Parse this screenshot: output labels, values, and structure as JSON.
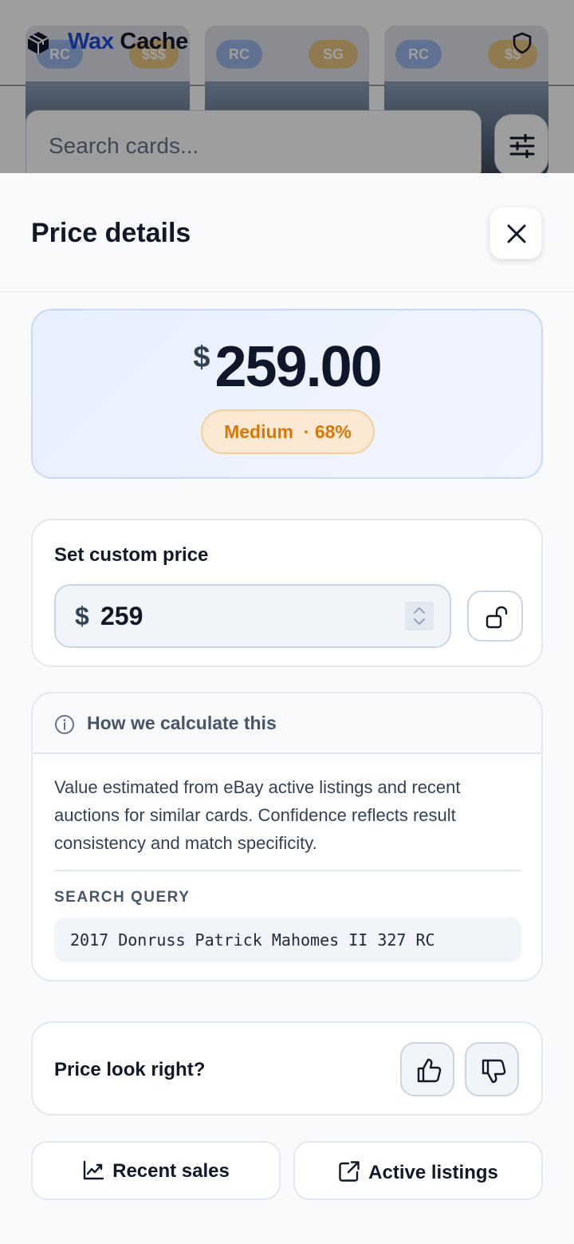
{
  "app": {
    "name_part1": "Wax",
    "name_part2": "Cache",
    "search_placeholder": "Search cards...",
    "card_badges": [
      {
        "left": "RC",
        "right": "$$$"
      },
      {
        "left": "RC",
        "right": "SG"
      },
      {
        "left": "RC",
        "right": "$$"
      }
    ]
  },
  "sheet": {
    "title": "Price details",
    "estimate": {
      "currency": "$",
      "value": "259.00",
      "confidence_label": "Medium",
      "confidence_pct": "· 68%"
    },
    "custom_price": {
      "label": "Set custom price",
      "currency": "$",
      "value": "259"
    },
    "calculation": {
      "heading": "How we calculate this",
      "body": "Value estimated from eBay active listings and recent auctions for similar cards. Confidence reflects result consistency and match specificity.",
      "query_label": "SEARCH QUERY",
      "query": "2017 Donruss Patrick Mahomes II 327 RC"
    },
    "feedback": {
      "question": "Price look right?"
    },
    "actions": {
      "recent_sales": "Recent sales",
      "active_listings": "Active listings"
    }
  },
  "colors": {
    "brand": "#1d4ed8",
    "confidence_medium": "#d97706"
  },
  "icons": [
    "cube-logo-icon",
    "shield-icon",
    "sliders-icon",
    "close-icon",
    "unlock-icon",
    "info-icon",
    "thumbs-up-icon",
    "thumbs-down-icon",
    "chart-line-icon",
    "external-link-icon"
  ]
}
